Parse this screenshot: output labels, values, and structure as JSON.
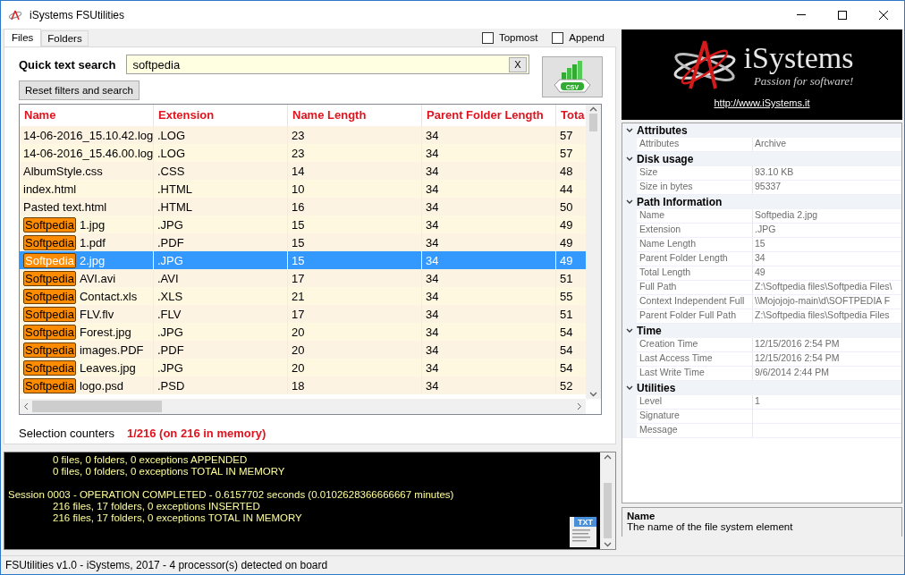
{
  "window": {
    "title": "iSystems FSUtilities"
  },
  "tabs": [
    {
      "label": "Files",
      "selected": true
    },
    {
      "label": "Folders",
      "selected": false
    }
  ],
  "options": [
    {
      "label": "Topmost",
      "checked": false
    },
    {
      "label": "Append",
      "checked": false
    }
  ],
  "search": {
    "label": "Quick text search",
    "value": "softpedia",
    "clear": "X",
    "reset": "Reset filters and search",
    "export_badge": "CSV"
  },
  "table": {
    "columns": [
      "Name",
      "Extension",
      "Name Length",
      "Parent Folder Length",
      "Tota"
    ],
    "rows": [
      {
        "cells": [
          "14-06-2016_15.10.42.log",
          ".LOG",
          "23",
          "34",
          "57"
        ],
        "selected": false
      },
      {
        "cells": [
          "14-06-2016_15.46.00.log",
          ".LOG",
          "23",
          "34",
          "57"
        ],
        "selected": false
      },
      {
        "cells": [
          "AlbumStyle.css",
          ".CSS",
          "14",
          "34",
          "48"
        ],
        "selected": false
      },
      {
        "cells": [
          "index.html",
          ".HTML",
          "10",
          "34",
          "44"
        ],
        "selected": false
      },
      {
        "cells": [
          "Pasted text.html",
          ".HTML",
          "16",
          "34",
          "50"
        ],
        "selected": false
      },
      {
        "match": "Softpedia",
        "cells": [
          "1.jpg",
          ".JPG",
          "15",
          "34",
          "49"
        ],
        "selected": false
      },
      {
        "match": "Softpedia",
        "cells": [
          "1.pdf",
          ".PDF",
          "15",
          "34",
          "49"
        ],
        "selected": false
      },
      {
        "match": "Softpedia",
        "cells": [
          "2.jpg",
          ".JPG",
          "15",
          "34",
          "49"
        ],
        "selected": true
      },
      {
        "match": "Softpedia",
        "cells": [
          "AVI.avi",
          ".AVI",
          "17",
          "34",
          "51"
        ],
        "selected": false
      },
      {
        "match": "Softpedia",
        "cells": [
          "Contact.xls",
          ".XLS",
          "21",
          "34",
          "55"
        ],
        "selected": false
      },
      {
        "match": "Softpedia",
        "cells": [
          "FLV.flv",
          ".FLV",
          "17",
          "34",
          "51"
        ],
        "selected": false
      },
      {
        "match": "Softpedia",
        "cells": [
          "Forest.jpg",
          ".JPG",
          "20",
          "34",
          "54"
        ],
        "selected": false
      },
      {
        "match": "Softpedia",
        "cells": [
          "images.PDF",
          ".PDF",
          "20",
          "34",
          "54"
        ],
        "selected": false
      },
      {
        "match": "Softpedia",
        "cells": [
          "Leaves.jpg",
          ".JPG",
          "20",
          "34",
          "54"
        ],
        "selected": false
      },
      {
        "match": "Softpedia",
        "cells": [
          "logo.psd",
          ".PSD",
          "18",
          "34",
          "52"
        ],
        "selected": false
      }
    ]
  },
  "counters": {
    "label": "Selection counters",
    "value": "1/216 (on 216 in memory)"
  },
  "log": [
    [
      {
        "text": "0 files, 0 folders, 0 exceptions APPENDED",
        "indent": true
      },
      {
        "text": "0 files, 0 folders, 0 exceptions TOTAL IN MEMORY",
        "indent": true
      }
    ],
    [
      {
        "text": "Session 0003 - OPERATION COMPLETED - 0.6157702 seconds (0.0102628366666667 minutes)",
        "indent": false
      },
      {
        "text": "216 files, 17 folders, 0 exceptions INSERTED",
        "indent": true
      },
      {
        "text": "216 files, 17 folders, 0 exceptions TOTAL IN MEMORY",
        "indent": true
      }
    ]
  ],
  "log_badge": "TXT",
  "logo": {
    "name": "iSystems",
    "tagline": "Passion for software!",
    "link": "http://www.iSystems.it"
  },
  "properties": [
    {
      "category": "Attributes",
      "expanded": true,
      "items": [
        {
          "name": "Attributes",
          "value": "Archive"
        }
      ]
    },
    {
      "category": "Disk usage",
      "expanded": true,
      "items": [
        {
          "name": "Size",
          "value": "93.10 KB"
        },
        {
          "name": "Size in bytes",
          "value": "95337"
        }
      ]
    },
    {
      "category": "Path Information",
      "expanded": true,
      "items": [
        {
          "name": "Name",
          "value": "Softpedia 2.jpg"
        },
        {
          "name": "Extension",
          "value": ".JPG"
        },
        {
          "name": "Name Length",
          "value": "15"
        },
        {
          "name": "Parent Folder Length",
          "value": "34"
        },
        {
          "name": "Total Length",
          "value": "49"
        },
        {
          "name": "Full Path",
          "value": "Z:\\Softpedia files\\Softpedia Files\\"
        },
        {
          "name": "Context Independent Full",
          "value": "\\\\Mojojojo-main\\d\\SOFTPEDIA F"
        },
        {
          "name": "Parent Folder Full Path",
          "value": "Z:\\Softpedia files\\Softpedia Files"
        }
      ]
    },
    {
      "category": "Time",
      "expanded": true,
      "items": [
        {
          "name": "Creation Time",
          "value": "12/15/2016 2:54 PM"
        },
        {
          "name": "Last Access Time",
          "value": "12/15/2016 2:54 PM"
        },
        {
          "name": "Last Write Time",
          "value": "9/6/2014 2:44 PM"
        }
      ]
    },
    {
      "category": "Utilities",
      "expanded": true,
      "items": [
        {
          "name": "Level",
          "value": "1"
        },
        {
          "name": "Signature"
        },
        {
          "name": "Message"
        }
      ]
    }
  ],
  "description": {
    "title": "Name",
    "text": "The name of the file system element"
  },
  "status_bar": "FSUtilities v1.0 - iSystems, 2017 - 4 processor(s) detected on board"
}
